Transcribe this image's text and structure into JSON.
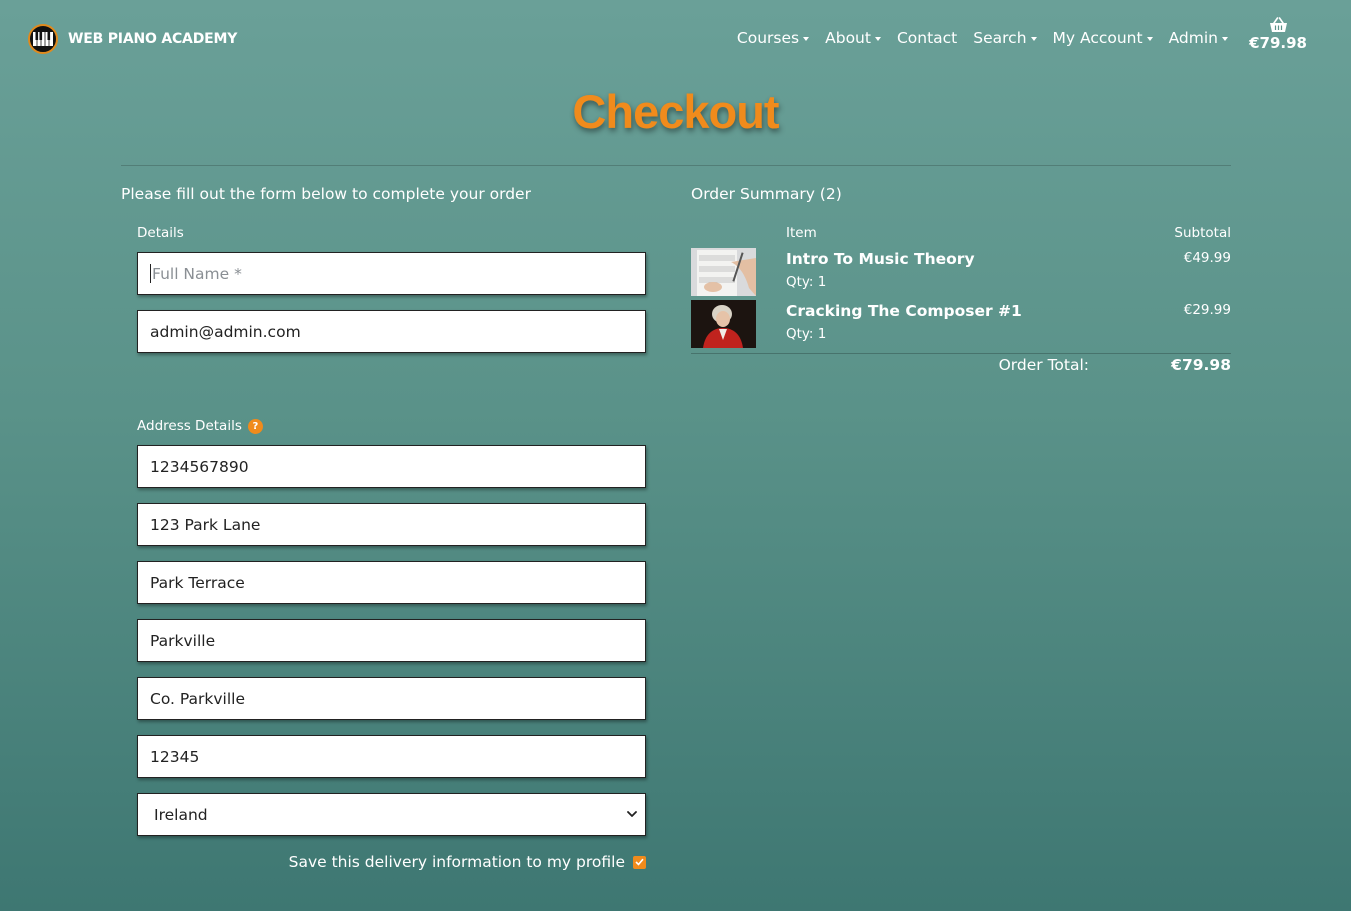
{
  "brand": {
    "name": "WEB PIANO ACADEMY"
  },
  "nav": {
    "items": [
      {
        "label": "Courses",
        "dropdown": true
      },
      {
        "label": "About",
        "dropdown": true
      },
      {
        "label": "Contact",
        "dropdown": false
      },
      {
        "label": "Search",
        "dropdown": true
      },
      {
        "label": "My Account",
        "dropdown": true
      },
      {
        "label": "Admin",
        "dropdown": true
      }
    ],
    "cart_icon": "basket-icon",
    "cart_total": "€79.98"
  },
  "page": {
    "title": "Checkout"
  },
  "form": {
    "intro": "Please fill out the form below to complete your order",
    "details_legend": "Details",
    "full_name_placeholder": "Full Name *",
    "full_name_value": "",
    "email_value": "admin@admin.com",
    "address_legend": "Address Details",
    "help_glyph": "?",
    "phone_value": "1234567890",
    "street1_value": "123 Park Lane",
    "street2_value": "Park Terrace",
    "town_value": "Parkville",
    "county_value": "Co. Parkville",
    "postcode_value": "12345",
    "country_value": "Ireland",
    "save_label": "Save this delivery information to my profile",
    "save_checked": true
  },
  "summary": {
    "title": "Order Summary (2)",
    "col_item": "Item",
    "col_subtotal": "Subtotal",
    "items": [
      {
        "name": "Intro To Music Theory",
        "qty": "Qty: 1",
        "price": "€49.99",
        "thumb": "sheet-music-hands"
      },
      {
        "name": "Cracking The Composer #1",
        "qty": "Qty: 1",
        "price": "€29.99",
        "thumb": "mozart-portrait"
      }
    ],
    "total_label": "Order Total:",
    "total_value": "€79.98"
  },
  "colors": {
    "accent": "#f08b1c",
    "bg_top": "#6aa098",
    "bg_bottom": "#3e7772"
  }
}
